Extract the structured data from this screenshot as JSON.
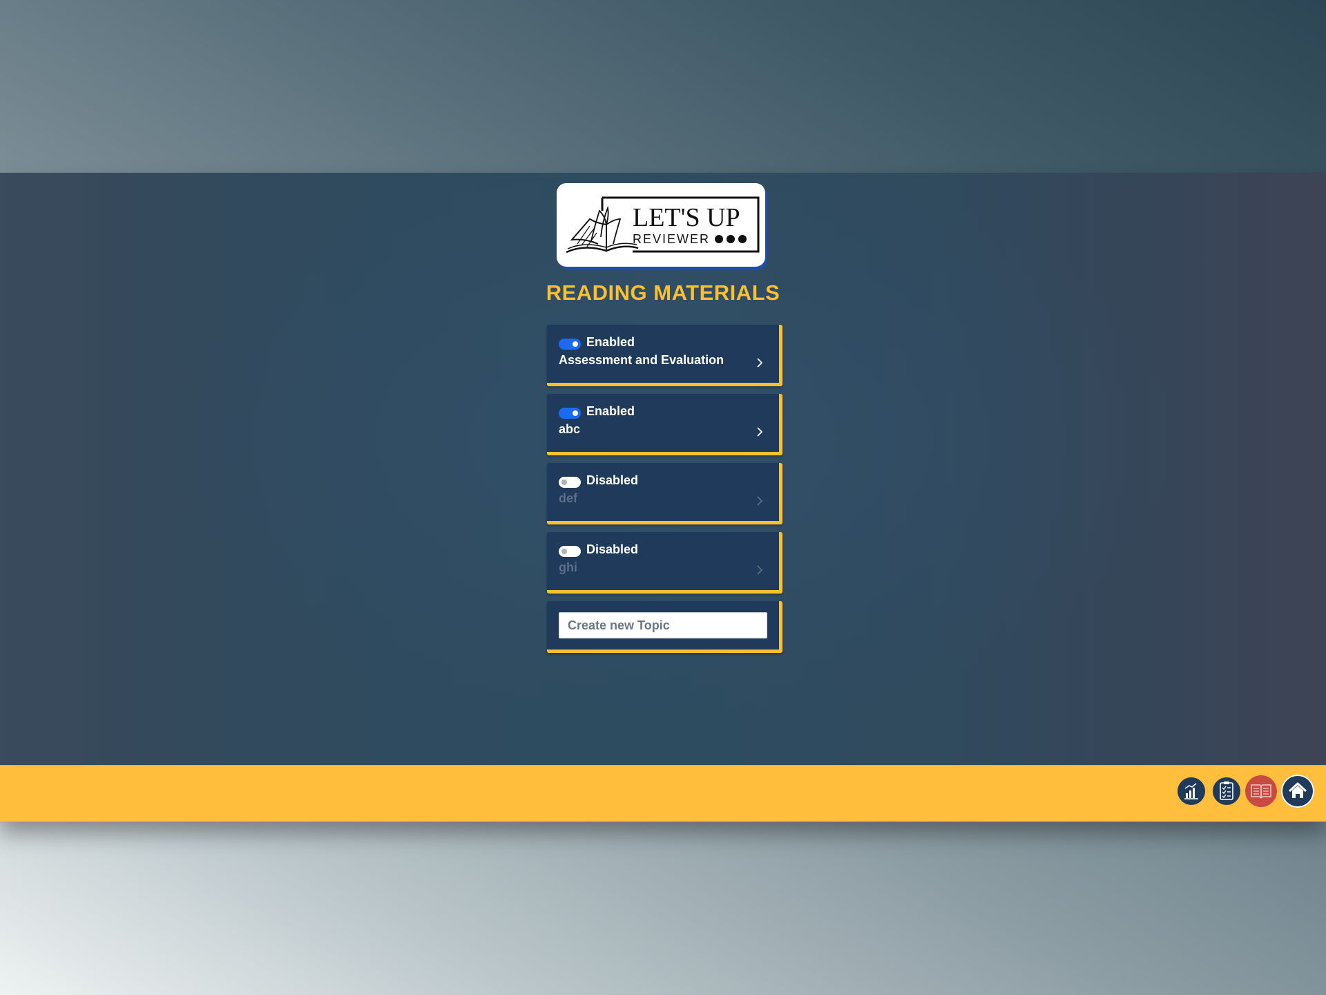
{
  "logo": {
    "line1": "LET'S UP",
    "line2": "REVIEWER"
  },
  "page_title": "READING MATERIALS",
  "topics": [
    {
      "status": "Enabled",
      "name": "Assessment and Evaluation",
      "enabled": true
    },
    {
      "status": "Enabled",
      "name": "abc",
      "enabled": true
    },
    {
      "status": "Disabled",
      "name": "def",
      "enabled": false
    },
    {
      "status": "Disabled",
      "name": "ghi",
      "enabled": false
    }
  ],
  "create_topic": {
    "placeholder": "Create new Topic",
    "value": ""
  },
  "footer_nav": [
    {
      "icon": "bar-chart-icon",
      "active": false
    },
    {
      "icon": "checklist-icon",
      "active": false
    },
    {
      "icon": "open-book-icon",
      "active": true
    },
    {
      "icon": "home-icon",
      "active": false
    }
  ],
  "colors": {
    "accent": "#fbbf33",
    "card": "#1f3a5a",
    "toggle_on": "#1d6af2",
    "footer": "#ffbe3c",
    "active_nav": "#c94a42"
  }
}
